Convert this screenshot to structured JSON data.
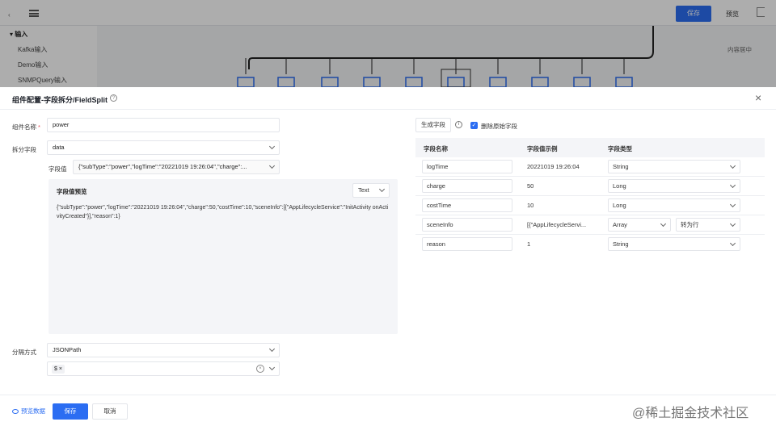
{
  "background": {
    "topbar": {
      "save_label": "保存",
      "preview_label": "预览"
    },
    "sidebar": {
      "group_label": "输入",
      "items": [
        "Kafka输入",
        "Demo输入",
        "SNMPQuery输入"
      ]
    },
    "canvas_hint": "内容居中"
  },
  "drawer": {
    "title": "组件配置-字段拆分/FieldSplit",
    "form": {
      "component_name_label": "组件名称",
      "component_name_value": "power",
      "split_field_label": "拆分字段",
      "split_field_value": "data",
      "field_value_label": "字段值",
      "field_value_value": "{\"subType\":\"power\",\"logTime\":\"20221019 19:26:04\",\"charge\":...",
      "preview_title": "字段值预览",
      "preview_format": "Text",
      "preview_text": "{\"subType\":\"power\",\"logTime\":\"20221019 19:26:04\",\"charge\":50,\"costTime\":10,\"sceneInfo\":[{\"AppLifecycleService\":\"InitActivity onActivityCreated\"}],\"reason\":1}",
      "separator_label": "分隔方式",
      "separator_value": "JSONPath",
      "path_tag": "$"
    },
    "right": {
      "generate_label": "生成字段",
      "delete_original_label": "删除原始字段",
      "columns": [
        "字段名称",
        "字段值示例",
        "字段类型"
      ],
      "rows": [
        {
          "name": "logTime",
          "example": "20221019 19:26:04",
          "type": "String",
          "extra": ""
        },
        {
          "name": "charge",
          "example": "50",
          "type": "Long",
          "extra": ""
        },
        {
          "name": "costTime",
          "example": "10",
          "type": "Long",
          "extra": ""
        },
        {
          "name": "sceneInfo",
          "example": "[{\"AppLifecycleServi...",
          "type": "Array",
          "extra": "转为行"
        },
        {
          "name": "reason",
          "example": "1",
          "type": "String",
          "extra": ""
        }
      ]
    },
    "footer": {
      "preview_data_label": "预览数据",
      "save_label": "保存",
      "cancel_label": "取消",
      "watermark": "@稀土掘金技术社区"
    }
  },
  "colors": {
    "primary": "#2b6df2",
    "required": "#e34d59"
  }
}
